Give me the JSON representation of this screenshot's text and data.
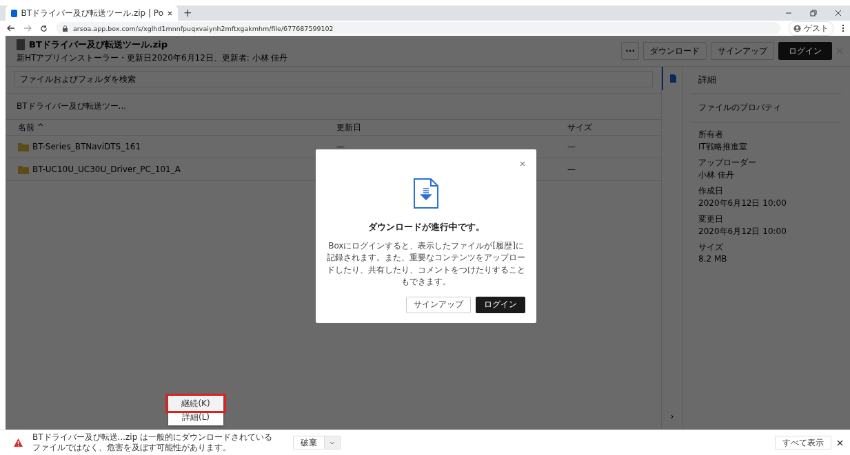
{
  "browser": {
    "tab_title": "BTドライバー及び転送ツール.zip | Po",
    "new_tab": "+",
    "url": "arsoa.app.box.com/s/xglhd1mnnfpuqxvaiynh2mftxgakmhm/file/677687599102",
    "profile": "ゲスト"
  },
  "header": {
    "title": "BTドライバー及び転送ツール.zip",
    "subtitle": "新HTアプリインストーラー・更新日2020年6月12日、更新者: 小林 佳丹",
    "more": "···",
    "buttons": [
      {
        "label": "ダウンロード",
        "kind": "outline"
      },
      {
        "label": "サインアップ",
        "kind": "outline"
      },
      {
        "label": "ログイン",
        "kind": "primary"
      }
    ]
  },
  "search": {
    "placeholder": "ファイルおよびフォルダを検索"
  },
  "breadcrumb": "BTドライバー及び転送ツー...",
  "table": {
    "columns": [
      "名前 ^",
      "更新日",
      "サイズ"
    ],
    "rows": [
      {
        "name": "BT-Series_BTNaviDTS_161",
        "modified": "—",
        "size": "—"
      },
      {
        "name": "BT-UC10U_UC30U_Driver_PC_101_A",
        "size": "—"
      }
    ]
  },
  "sidebar": {
    "title": "詳細",
    "section": "ファイルのプロパティ",
    "properties": [
      {
        "label": "所有者",
        "value": "IT戦略推進室"
      },
      {
        "label": "アップローダー",
        "value": "小林 佳丹"
      },
      {
        "label": "作成日",
        "value": "2020年6月12日 10:00"
      },
      {
        "label": "変更日",
        "value": "2020年6月12日 10:00"
      },
      {
        "label": "サイズ",
        "value": "8.2 MB"
      }
    ],
    "expand": "›"
  },
  "modal": {
    "title": "ダウンロードが進行中です。",
    "body": "Boxにログインすると、表示したファイルが[履歴]に記録されます。また、重要なコンテンツをアップロードしたり、共有したり、コメントをつけたりすることもできます。",
    "buttons": [
      {
        "label": "サインアップ",
        "kind": "outline"
      },
      {
        "label": "ログイン",
        "kind": "primary"
      }
    ]
  },
  "context_menu": {
    "items": [
      {
        "label": "継続(K)",
        "highlighted": true
      },
      {
        "label": "詳細(L)",
        "highlighted": false
      }
    ]
  },
  "download_bar": {
    "message": "BTドライバー及び転送...zip は一般的にダウンロードされているファイルではなく、危害を及ぼす可能性があります。",
    "discard": "破棄",
    "show_all": "すべて表示"
  }
}
